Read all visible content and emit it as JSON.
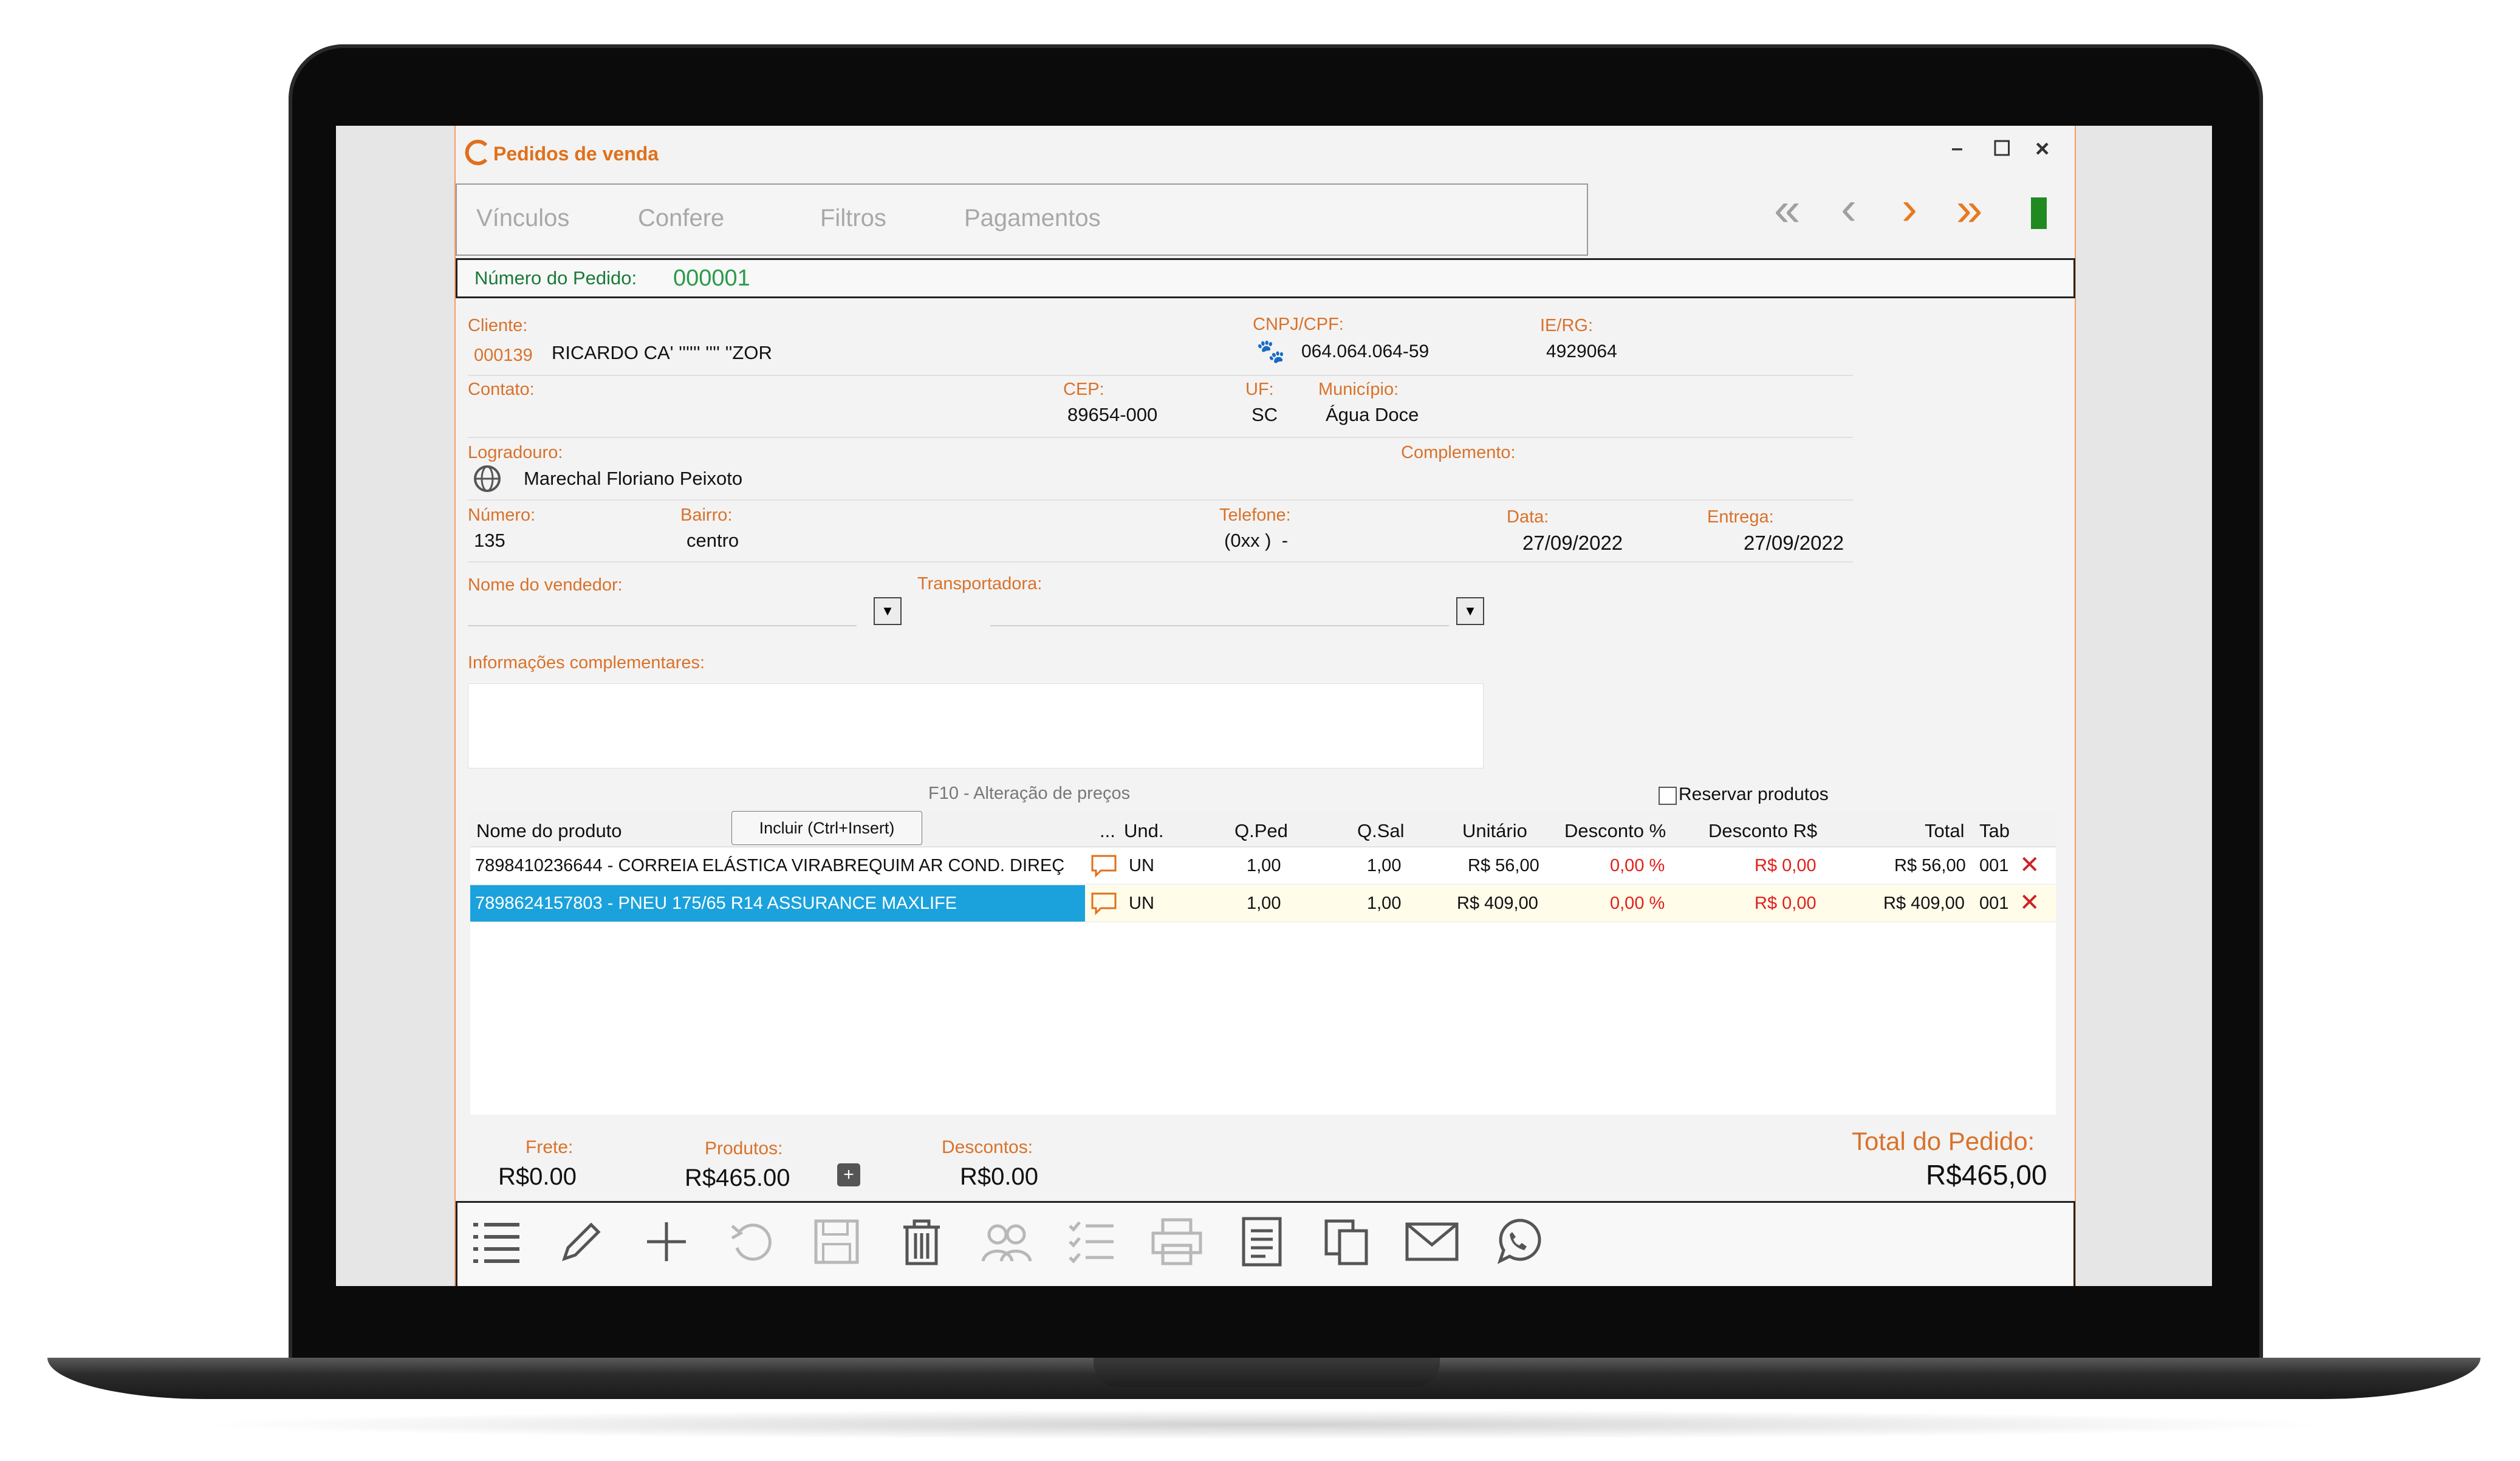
{
  "window": {
    "title": "Pedidos de venda",
    "controls": {
      "minimize": "–",
      "maximize": "☐",
      "close": "×"
    }
  },
  "tabs": [
    "Vínculos",
    "Confere",
    "Filtros",
    "Pagamentos"
  ],
  "order": {
    "number_label": "Número do Pedido:",
    "number": "000001"
  },
  "client": {
    "label": "Cliente:",
    "code": "000139",
    "name": "RICARDO CA' '''''' '''' ''ZOR",
    "cnpj_label": "CNPJ/CPF:",
    "cnpj": "064.064.064-59",
    "ie_label": "IE/RG:",
    "ie": "4929064",
    "contact_label": "Contato:",
    "contact": "",
    "cep_label": "CEP:",
    "cep": "89654-000",
    "uf_label": "UF:",
    "uf": "SC",
    "city_label": "Município:",
    "city": "Água Doce",
    "street_label": "Logradouro:",
    "street": "Marechal Floriano Peixoto",
    "complement_label": "Complemento:",
    "complement": "",
    "number_label": "Número:",
    "number": "135",
    "district_label": "Bairro:",
    "district": "centro",
    "phone_label": "Telefone:",
    "phone": "(0xx )  -",
    "date_label": "Data:",
    "date": "27/09/2022",
    "delivery_label": "Entrega:",
    "delivery": "27/09/2022"
  },
  "seller": {
    "label": "Nome do vendedor:",
    "value": ""
  },
  "carrier": {
    "label": "Transportadora:",
    "value": ""
  },
  "info": {
    "label": "Informações complementares:",
    "value": ""
  },
  "price_hint": "F10 - Alteração de preços",
  "reserve_label": "Reservar produtos",
  "include_button": "Incluir (Ctrl+Insert)",
  "table": {
    "headers": [
      "Nome do produto",
      "...",
      "Und.",
      "Q.Ped",
      "Q.Sal",
      "Unitário",
      "Desconto %",
      "Desconto R$",
      "Total",
      "Tab"
    ],
    "rows": [
      {
        "product": "7898410236644 - CORREIA ELÁSTICA VIRABREQUIM AR COND. DIREÇ",
        "unit": "UN",
        "qped": "1,00",
        "qsal": "1,00",
        "price": "R$ 56,00",
        "disc_pct": "0,00 %",
        "disc_val": "R$ 0,00",
        "total": "R$ 56,00",
        "tab": "001"
      },
      {
        "product": "7898624157803 - PNEU 175/65 R14 ASSURANCE MAXLIFE",
        "unit": "UN",
        "qped": "1,00",
        "qsal": "1,00",
        "price": "R$ 409,00",
        "disc_pct": "0,00 %",
        "disc_val": "R$ 0,00",
        "total": "R$ 409,00",
        "tab": "001"
      }
    ]
  },
  "totals": {
    "freight_label": "Frete:",
    "freight": "R$0.00",
    "products_label": "Produtos:",
    "products": "R$465.00",
    "discounts_label": "Descontos:",
    "discounts": "R$0.00",
    "order_total_label": "Total do Pedido:",
    "order_total": "R$465,00"
  },
  "toolbar_icons": [
    "list-icon",
    "pencil-icon",
    "plus-icon",
    "undo-icon",
    "save-icon",
    "trash-icon",
    "users-icon",
    "checklist-icon",
    "print-icon",
    "document-icon",
    "copy-icon",
    "mail-icon",
    "whatsapp-icon"
  ],
  "colors": {
    "accent": "#e0701a",
    "label": "#d9722a",
    "selected_row": "#1ba2dc",
    "discount_red": "#e0201a",
    "status_green": "#1f8a1f",
    "order_number_green": "#2a9a4a"
  }
}
